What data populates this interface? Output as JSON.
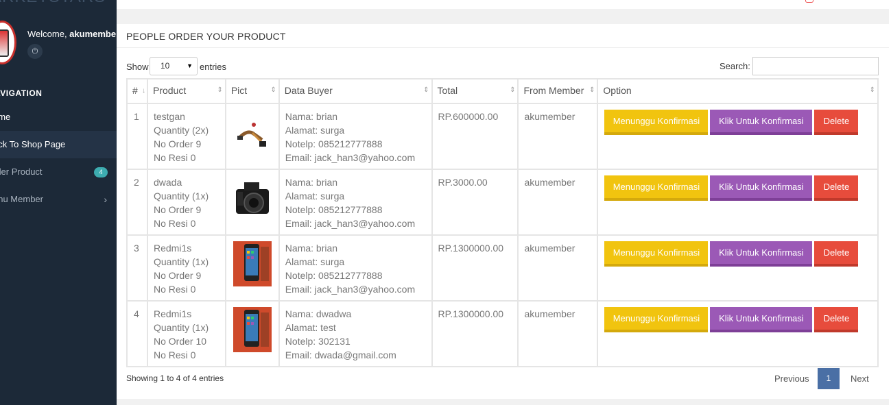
{
  "sidebar": {
    "brand": "ARKETSTARS",
    "welcome_prefix": "Welcome, ",
    "username": "akumember",
    "power_icon": "⏻",
    "nav_header": "AVIGATION",
    "items": [
      {
        "label": "ome"
      },
      {
        "label": "ack To Shop Page"
      },
      {
        "label": "rder Product",
        "badge": "4"
      },
      {
        "label": "enu Member",
        "chevron": "›"
      }
    ]
  },
  "panel": {
    "title": "PEOPLE ORDER YOUR PRODUCT",
    "show_label": "Show",
    "entries_value": "10",
    "entries_label": "entries",
    "search_label": "Search:",
    "search_value": ""
  },
  "table": {
    "columns": [
      "#",
      "Product",
      "Pict",
      "Data Buyer",
      "Total",
      "From Member",
      "Option"
    ],
    "rows": [
      {
        "num": "1",
        "product": "testgan",
        "qty": "Quantity (2x)",
        "order": "No Order 9",
        "resi": "No Resi 0",
        "pict": "cable-part",
        "nama": "Nama: brian",
        "alamat": "Alamat: surga",
        "notelp": "Notelp: 085212777888",
        "email": "Email: jack_han3@yahoo.com",
        "total": "RP.600000.00",
        "member": "akumember"
      },
      {
        "num": "2",
        "product": "dwada",
        "qty": "Quantity (1x)",
        "order": "No Order 9",
        "resi": "No Resi 0",
        "pict": "camera",
        "nama": "Nama: brian",
        "alamat": "Alamat: surga",
        "notelp": "Notelp: 085212777888",
        "email": "Email: jack_han3@yahoo.com",
        "total": "RP.3000.00",
        "member": "akumember"
      },
      {
        "num": "3",
        "product": "Redmi1s",
        "qty": "Quantity (1x)",
        "order": "No Order 9",
        "resi": "No Resi 0",
        "pict": "phone",
        "nama": "Nama: brian",
        "alamat": "Alamat: surga",
        "notelp": "Notelp: 085212777888",
        "email": "Email: jack_han3@yahoo.com",
        "total": "RP.1300000.00",
        "member": "akumember"
      },
      {
        "num": "4",
        "product": "Redmi1s",
        "qty": "Quantity (1x)",
        "order": "No Order 10",
        "resi": "No Resi 0",
        "pict": "phone",
        "nama": "Nama: dwadwa",
        "alamat": "Alamat: test",
        "notelp": "Notelp: 302131",
        "email": "Email: dwada@gmail.com",
        "total": "RP.1300000.00",
        "member": "akumember"
      }
    ],
    "buttons": {
      "pending": "Menunggu Konfirmasi",
      "confirm": "Klik Untuk Konfirmasi",
      "delete": "Delete"
    }
  },
  "footer": {
    "showing": "Showing 1 to 4 of 4 entries",
    "previous": "Previous",
    "current_page": "1",
    "next": "Next"
  },
  "colors": {
    "sidebar_bg": "#1c2938",
    "btn_yellow": "#f1c40f",
    "btn_purple": "#9b59b6",
    "btn_red": "#e74c3c",
    "page_active": "#4a6fa5"
  }
}
